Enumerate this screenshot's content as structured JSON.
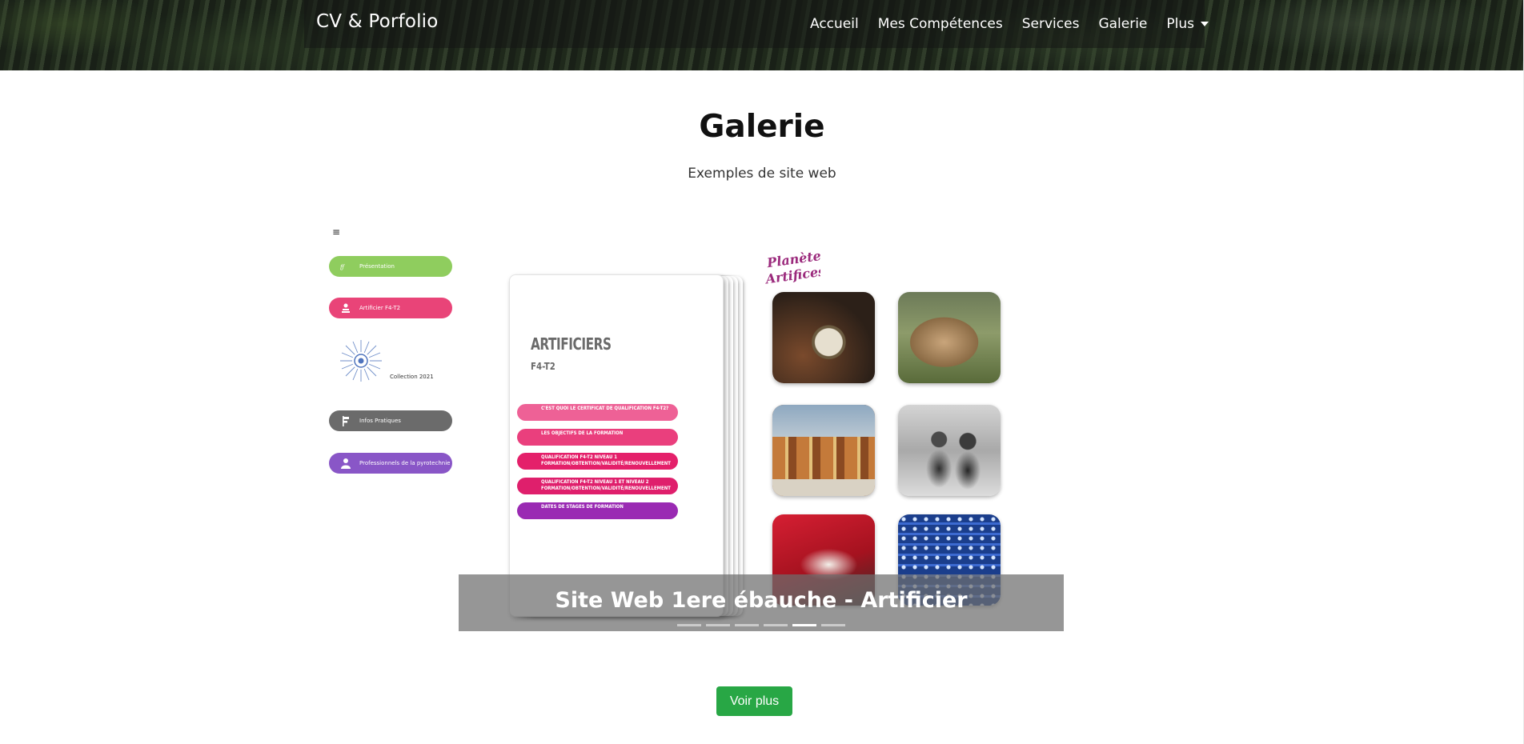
{
  "navbar": {
    "brand": "CV & Porfolio",
    "links": [
      "Accueil",
      "Mes Compétences",
      "Services",
      "Galerie"
    ],
    "more_label": "Plus"
  },
  "gallery": {
    "title": "Galerie",
    "subtitle": "Exemples de site web"
  },
  "slide": {
    "sidebar": {
      "hamburger": "≡",
      "items": [
        "Présentation",
        "Artificier F4-T2",
        "Infos Pratiques",
        "Professionnels de la pyrotechnie"
      ],
      "collection_label": "Collection 2021"
    },
    "book": {
      "title": "ARTIFICIERS",
      "subtitle": "F4-T2",
      "menu": [
        "C'est quoi le certificat de qualification F4-T2?",
        "Les objectifs de la formation",
        "Qualification F4-T2 niveau 1 formation/obtention/validité/renouvellement",
        "Qualification F4-T2 niveau 1 et niveau 2 formation/obtention/validité/renouvellement",
        "Dates de stages de formation"
      ]
    },
    "logo": "Planète Artifices",
    "caption": "Site Web 1ere ébauche - Artificier",
    "indicator_count": 6,
    "active_indicator": 5
  },
  "actions": {
    "more_button": "Voir plus"
  },
  "colors": {
    "accent_button": "#28a745",
    "pill_green": "#8fcd5e",
    "pill_pink": "#e94478",
    "pill_gray": "#6b6b6b",
    "pill_purple": "#8956c7"
  }
}
